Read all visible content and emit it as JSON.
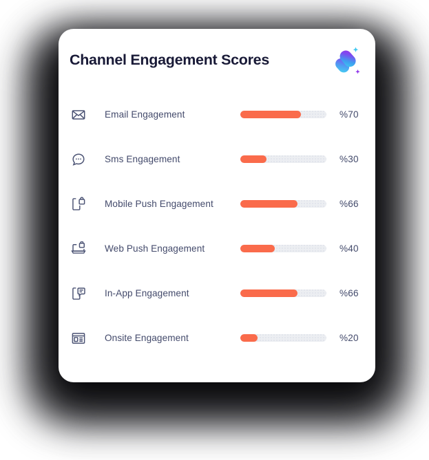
{
  "card": {
    "title": "Channel Engagement Scores",
    "logo_icon": "gradient-sparkle-logo",
    "accent_color": "#fa6b4b",
    "track_color": "#eceef2",
    "title_color": "#191a37",
    "text_color": "#434a6b"
  },
  "chart_data": {
    "type": "bar",
    "title": "Channel Engagement Scores",
    "xlabel": "",
    "ylabel": "",
    "orientation": "horizontal",
    "xlim": [
      0,
      100
    ],
    "grid": false,
    "legend": false,
    "value_format": "%{value}",
    "categories": [
      "Email Engagement",
      "Sms Engagement",
      "Mobile Push Engagement",
      "Web Push Engagement",
      "In-App Engagement",
      "Onsite Engagement"
    ],
    "values": [
      70,
      30,
      66,
      40,
      66,
      20
    ]
  },
  "rows": [
    {
      "icon": "envelope-icon",
      "label": "Email Engagement",
      "value": 70,
      "pct_label": "%70"
    },
    {
      "icon": "chat-bubble-icon",
      "label": "Sms Engagement",
      "value": 30,
      "pct_label": "%30"
    },
    {
      "icon": "mobile-push-icon",
      "label": "Mobile Push Engagement",
      "value": 66,
      "pct_label": "%66"
    },
    {
      "icon": "web-push-icon",
      "label": "Web Push Engagement",
      "value": 40,
      "pct_label": "%40"
    },
    {
      "icon": "in-app-message-icon",
      "label": "In-App Engagement",
      "value": 66,
      "pct_label": "%66"
    },
    {
      "icon": "onsite-window-icon",
      "label": "Onsite Engagement",
      "value": 20,
      "pct_label": "%20"
    }
  ]
}
